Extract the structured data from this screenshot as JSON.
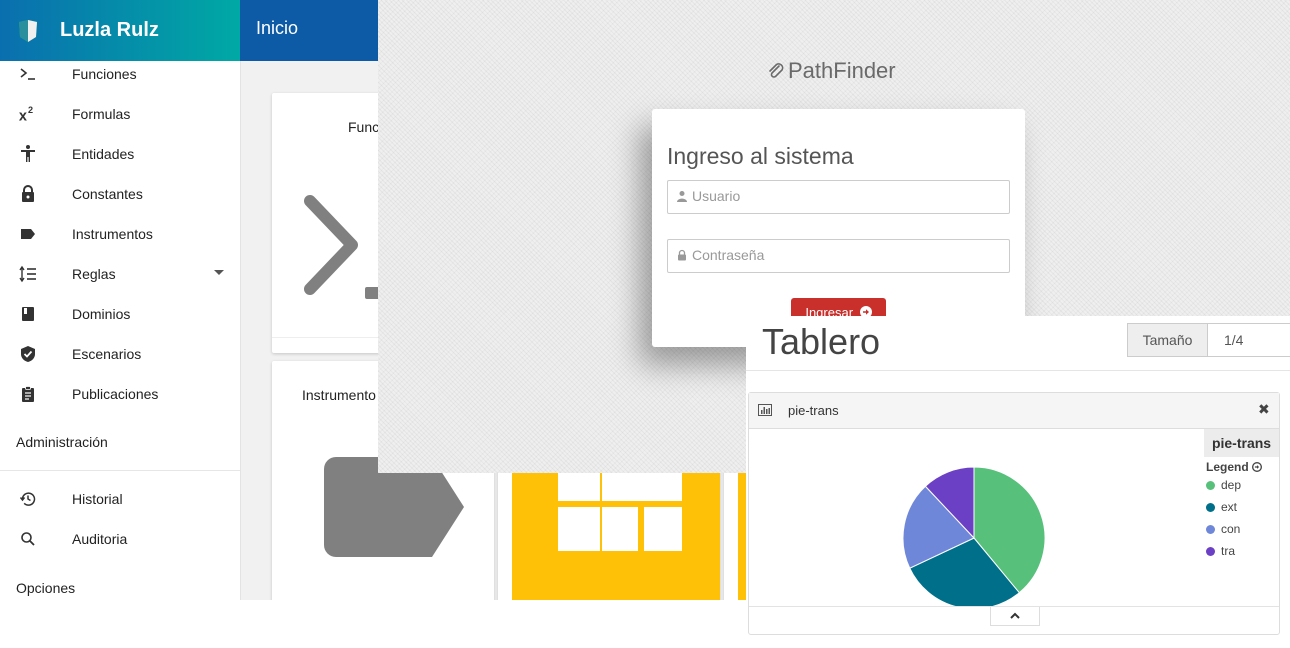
{
  "app": {
    "brand": "Luzla Rulz",
    "breadcrumb": "Inicio",
    "nav": [
      {
        "label": "Funciones",
        "icon": "terminal-icon"
      },
      {
        "label": "Formulas",
        "icon": "superscript-icon"
      },
      {
        "label": "Entidades",
        "icon": "person-icon"
      },
      {
        "label": "Constantes",
        "icon": "lock-icon"
      },
      {
        "label": "Instrumentos",
        "icon": "label-icon"
      },
      {
        "label": "Reglas",
        "icon": "format-line-spacing-icon"
      },
      {
        "label": "Dominios",
        "icon": "book-icon"
      },
      {
        "label": "Escenarios",
        "icon": "verified-shield-icon"
      },
      {
        "label": "Publicaciones",
        "icon": "assignment-icon"
      }
    ],
    "admin_section": "Administración",
    "admin_nav": [
      {
        "label": "Historial",
        "icon": "history-icon"
      },
      {
        "label": "Auditoria",
        "icon": "search-icon"
      }
    ],
    "options_section": "Opciones",
    "cards": [
      {
        "title": "Func"
      },
      {
        "title": "Instrumento"
      }
    ]
  },
  "login": {
    "logo_text": "PathFinder",
    "title": "Ingreso al sistema",
    "user_placeholder": "Usuario",
    "password_placeholder": "Contraseña",
    "submit_label": "Ingresar"
  },
  "dashboard": {
    "title": "Tablero",
    "size_label": "Tamaño",
    "size_value": "1/4",
    "panel": {
      "title": "pie-trans",
      "close": "✖",
      "legend_title": "pie-trans",
      "legend_subtitle": "Legend"
    }
  },
  "chart_data": {
    "type": "pie",
    "title": "pie-trans",
    "legend_placement": "right",
    "series": [
      {
        "name": "dep",
        "value": 39,
        "color": "#57c17b"
      },
      {
        "name": "ext",
        "value": 29,
        "color": "#006f8a"
      },
      {
        "name": "con",
        "value": 20,
        "color": "#6f87d8"
      },
      {
        "name": "tra",
        "value": 12,
        "color": "#6b40c4"
      }
    ]
  },
  "colors": {
    "brand_gradient_start": "#0a6fae",
    "brand_gradient_end": "#00a9a5",
    "topbar": "#0d5aa7",
    "login_button": "#c9302c",
    "tile_yellow": "#ffc107",
    "tile_gray": "#808080"
  }
}
